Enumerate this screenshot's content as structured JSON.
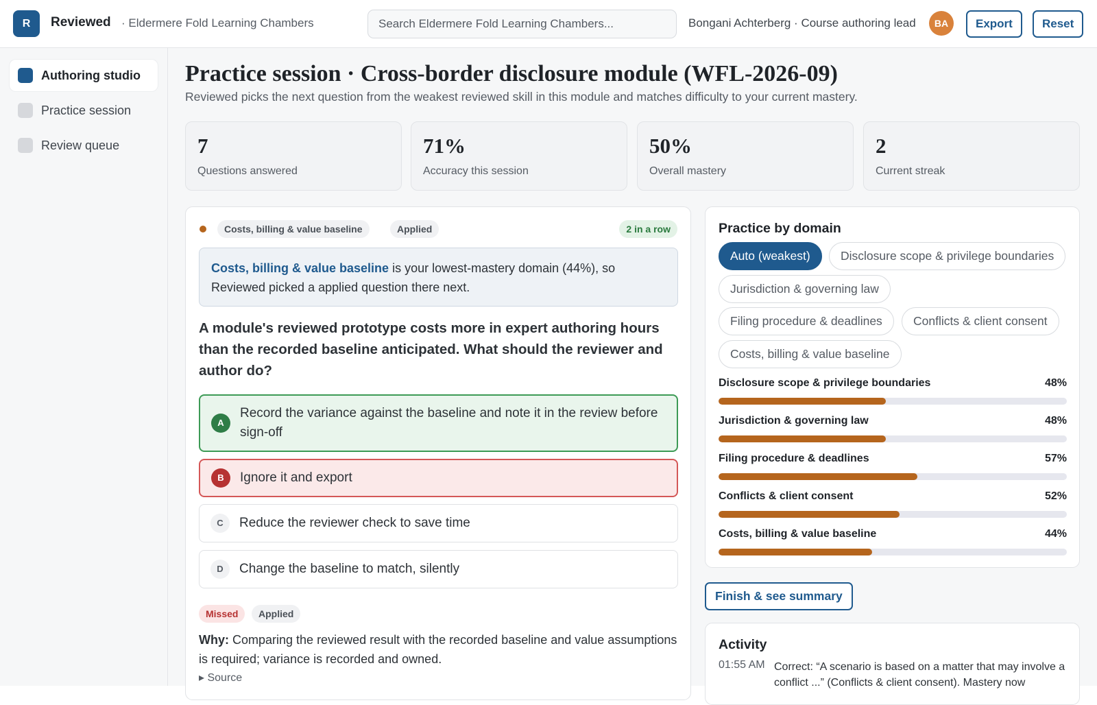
{
  "app": {
    "logo_letter": "R",
    "name": "Reviewed",
    "org": "· Eldermere Fold Learning Chambers",
    "search_placeholder": "Search Eldermere Fold Learning Chambers...",
    "user": "Bongani Achterberg · Course authoring lead",
    "avatar_initials": "BA",
    "export_label": "Export",
    "reset_label": "Reset",
    "accent_color": "#1f5a8e"
  },
  "sidebar": {
    "items": [
      {
        "label": "Authoring studio",
        "active": true
      },
      {
        "label": "Practice session",
        "active": false
      },
      {
        "label": "Review queue",
        "active": false
      }
    ]
  },
  "page": {
    "title": "Practice session · Cross-border disclosure module (WFL-2026-09)",
    "subtitle": "Reviewed picks the next question from the weakest reviewed skill in this module and matches difficulty to your current mastery."
  },
  "stats": [
    {
      "value": "7",
      "label": "Questions answered"
    },
    {
      "value": "71%",
      "label": "Accuracy this session"
    },
    {
      "value": "50%",
      "label": "Overall mastery"
    },
    {
      "value": "2",
      "label": "Current streak"
    }
  ],
  "question_card": {
    "domain_chip": "Costs, billing & value baseline",
    "level_chip": "Applied",
    "streak_chip": "2 in a row",
    "explain_domain": "Costs, billing & value baseline",
    "explain_rest": " is your lowest-mastery domain (44%), so Reviewed picked a applied question there next.",
    "question": "A module's reviewed prototype costs more in expert authoring hours than the recorded baseline anticipated. What should the reviewer and author do?",
    "options": [
      {
        "letter": "A",
        "text": "Record the variance against the baseline and note it in the review before sign-off",
        "state": "correct"
      },
      {
        "letter": "B",
        "text": "Ignore it and export",
        "state": "wrong"
      },
      {
        "letter": "C",
        "text": "Reduce the reviewer check to save time",
        "state": "neutral"
      },
      {
        "letter": "D",
        "text": "Change the baseline to match, silently",
        "state": "neutral"
      }
    ],
    "result_chip": "Missed",
    "result_level_chip": "Applied",
    "why_label": "Why:",
    "why_text": " Comparing the reviewed result with the recorded baseline and value assumptions is required; variance is recorded and owned.",
    "source_label": "▸ Source"
  },
  "domains": {
    "title": "Practice by domain",
    "filters": [
      {
        "label": "Auto (weakest)",
        "active": true
      },
      {
        "label": "Disclosure scope & privilege boundaries",
        "active": false
      },
      {
        "label": "Jurisdiction & governing law",
        "active": false
      },
      {
        "label": "Filing procedure & deadlines",
        "active": false
      },
      {
        "label": "Conflicts & client consent",
        "active": false
      },
      {
        "label": "Costs, billing & value baseline",
        "active": false
      }
    ],
    "mastery": [
      {
        "name": "Disclosure scope & privilege boundaries",
        "pct_label": "48%",
        "fraction": 0.48
      },
      {
        "name": "Jurisdiction & governing law",
        "pct_label": "48%",
        "fraction": 0.48
      },
      {
        "name": "Filing procedure & deadlines",
        "pct_label": "57%",
        "fraction": 0.57
      },
      {
        "name": "Conflicts & client consent",
        "pct_label": "52%",
        "fraction": 0.52
      },
      {
        "name": "Costs, billing & value baseline",
        "pct_label": "44%",
        "fraction": 0.44
      }
    ],
    "bar_color": "#b5651d"
  },
  "finish_label": "Finish & see summary",
  "activity": {
    "title": "Activity",
    "entries": [
      {
        "time": "01:55 AM",
        "text": "Correct: “A scenario is based on a matter that may involve a conflict ...” (Conflicts & client consent). Mastery now"
      }
    ]
  }
}
